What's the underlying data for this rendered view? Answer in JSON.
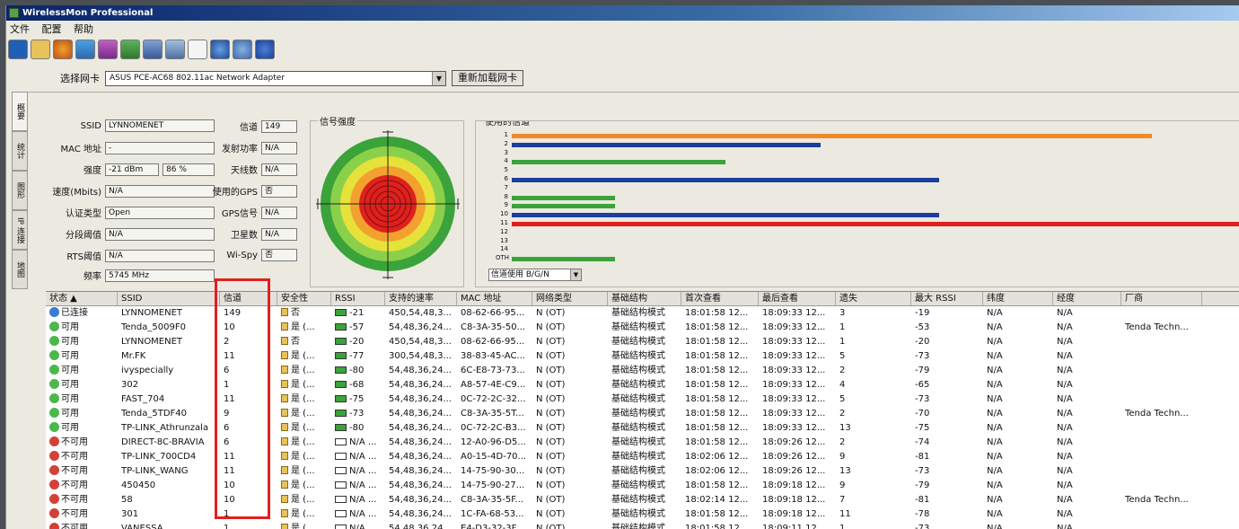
{
  "window": {
    "title": "WirelessMon Professional"
  },
  "menu": [
    "文件",
    "配置",
    "帮助"
  ],
  "toolbar": {
    "icons": [
      "save-icon",
      "open-icon",
      "refresh-icon",
      "scan-icon",
      "export-icon",
      "network-icon",
      "print-icon",
      "settings-icon",
      "doc-icon",
      "help-icon",
      "globe-icon",
      "info-icon"
    ]
  },
  "adapter": {
    "label": "选择网卡",
    "value": "ASUS PCE-AC68 802.11ac Network Adapter",
    "reload_label": "重新加载网卡"
  },
  "vtabs": [
    "概要",
    "统计",
    "图形",
    "IP 连接",
    "地图"
  ],
  "info": {
    "ssid_label": "SSID",
    "ssid": "LYNNOMENET",
    "mac_label": "MAC 地址",
    "mac": "-",
    "strength_label": "强度",
    "strength_dbm": "-21 dBm",
    "strength_pct": "86 %",
    "rate_label": "速度(Mbits)",
    "rate": "N/A",
    "auth_label": "认证类型",
    "auth": "Open",
    "frag_label": "分段阈值",
    "frag": "N/A",
    "rts_label": "RTS阈值",
    "rts": "N/A",
    "freq_label": "频率",
    "freq": "5745 MHz",
    "channel_label": "信道",
    "channel": "149",
    "txpower_label": "发射功率",
    "txpower": "N/A",
    "antenna_label": "天线数",
    "antenna": "N/A",
    "gps_label": "使用的GPS",
    "gps": "否",
    "gpssig_label": "GPS信号",
    "gpssig": "N/A",
    "sat_label": "卫星数",
    "sat": "N/A",
    "wispy_label": "Wi-Spy",
    "wispy": "否"
  },
  "signal": {
    "title": "信号强度"
  },
  "channels": {
    "title": "使用的信道",
    "labels": [
      "1",
      "2",
      "3",
      "4",
      "5",
      "6",
      "7",
      "8",
      "9",
      "10",
      "11",
      "12",
      "13",
      "14",
      "OTH"
    ],
    "bars": [
      {
        "ch": 1,
        "value": 0.87,
        "color": "#f0892a"
      },
      {
        "ch": 2,
        "value": 0.42,
        "color": "#1c3f9c"
      },
      {
        "ch": 4,
        "value": 0.29,
        "color": "#3aa33a"
      },
      {
        "ch": 6,
        "value": 0.58,
        "color": "#1c3f9c"
      },
      {
        "ch": 8,
        "value": 0.14,
        "color": "#3aa33a"
      },
      {
        "ch": 9,
        "value": 0.14,
        "color": "#3aa33a"
      },
      {
        "ch": 10,
        "value": 0.58,
        "color": "#1c3f9c"
      },
      {
        "ch": 11,
        "value": 1.0,
        "color": "#e0201d"
      },
      {
        "ch": 15,
        "value": 0.14,
        "color": "#3aa33a"
      }
    ],
    "band_select": "信道使用 B/G/N"
  },
  "table": {
    "headers": [
      "状态 ▲",
      "SSID",
      "信道",
      "安全性",
      "RSSI",
      "支持的速率",
      "MAC 地址",
      "网络类型",
      "基础结构",
      "首次查看",
      "最后查看",
      "遗失",
      "最大 RSSI",
      "纬度",
      "经度",
      "厂商"
    ],
    "rows": [
      {
        "status": "已连接",
        "dot": "#3a7bd5",
        "ssid": "LYNNOMENET",
        "channel": "149",
        "sec": "否",
        "rssi": "-21",
        "rates": "450,54,48,3...",
        "mac": "08-62-66-95...",
        "nettype": "N (OT)",
        "infra": "基础结构模式",
        "first": "18:01:58 12...",
        "last": "18:09:33 12...",
        "lost": "3",
        "maxrssi": "-19",
        "lat": "N/A",
        "lon": "N/A",
        "vendor": ""
      },
      {
        "status": "可用",
        "dot": "#4cb84c",
        "ssid": "Tenda_5009F0",
        "channel": "10",
        "sec": "是 (...",
        "rssi": "-57",
        "rates": "54,48,36,24...",
        "mac": "C8-3A-35-50...",
        "nettype": "N (OT)",
        "infra": "基础结构模式",
        "first": "18:01:58 12...",
        "last": "18:09:33 12...",
        "lost": "1",
        "maxrssi": "-53",
        "lat": "N/A",
        "lon": "N/A",
        "vendor": "Tenda Techn..."
      },
      {
        "status": "可用",
        "dot": "#4cb84c",
        "ssid": "LYNNOMENET",
        "channel": "2",
        "sec": "否",
        "rssi": "-20",
        "rates": "450,54,48,3...",
        "mac": "08-62-66-95...",
        "nettype": "N (OT)",
        "infra": "基础结构模式",
        "first": "18:01:58 12...",
        "last": "18:09:33 12...",
        "lost": "1",
        "maxrssi": "-20",
        "lat": "N/A",
        "lon": "N/A",
        "vendor": ""
      },
      {
        "status": "可用",
        "dot": "#4cb84c",
        "ssid": "Mr.FK",
        "channel": "11",
        "sec": "是 (...",
        "rssi": "-77",
        "rates": "300,54,48,3...",
        "mac": "38-83-45-AC...",
        "nettype": "N (OT)",
        "infra": "基础结构模式",
        "first": "18:01:58 12...",
        "last": "18:09:33 12...",
        "lost": "5",
        "maxrssi": "-73",
        "lat": "N/A",
        "lon": "N/A",
        "vendor": ""
      },
      {
        "status": "可用",
        "dot": "#4cb84c",
        "ssid": "ivyspecially",
        "channel": "6",
        "sec": "是 (...",
        "rssi": "-80",
        "rates": "54,48,36,24...",
        "mac": "6C-E8-73-73...",
        "nettype": "N (OT)",
        "infra": "基础结构模式",
        "first": "18:01:58 12...",
        "last": "18:09:33 12...",
        "lost": "2",
        "maxrssi": "-79",
        "lat": "N/A",
        "lon": "N/A",
        "vendor": ""
      },
      {
        "status": "可用",
        "dot": "#4cb84c",
        "ssid": "302",
        "channel": "1",
        "sec": "是 (...",
        "rssi": "-68",
        "rates": "54,48,36,24...",
        "mac": "A8-57-4E-C9...",
        "nettype": "N (OT)",
        "infra": "基础结构模式",
        "first": "18:01:58 12...",
        "last": "18:09:33 12...",
        "lost": "4",
        "maxrssi": "-65",
        "lat": "N/A",
        "lon": "N/A",
        "vendor": ""
      },
      {
        "status": "可用",
        "dot": "#4cb84c",
        "ssid": "FAST_704",
        "channel": "11",
        "sec": "是 (...",
        "rssi": "-75",
        "rates": "54,48,36,24...",
        "mac": "0C-72-2C-32...",
        "nettype": "N (OT)",
        "infra": "基础结构模式",
        "first": "18:01:58 12...",
        "last": "18:09:33 12...",
        "lost": "5",
        "maxrssi": "-73",
        "lat": "N/A",
        "lon": "N/A",
        "vendor": ""
      },
      {
        "status": "可用",
        "dot": "#4cb84c",
        "ssid": "Tenda_5TDF40",
        "channel": "9",
        "sec": "是 (...",
        "rssi": "-73",
        "rates": "54,48,36,24...",
        "mac": "C8-3A-35-5T...",
        "nettype": "N (OT)",
        "infra": "基础结构模式",
        "first": "18:01:58 12...",
        "last": "18:09:33 12...",
        "lost": "2",
        "maxrssi": "-70",
        "lat": "N/A",
        "lon": "N/A",
        "vendor": "Tenda Techn..."
      },
      {
        "status": "可用",
        "dot": "#4cb84c",
        "ssid": "TP-LINK_Athrunzala",
        "channel": "6",
        "sec": "是 (...",
        "rssi": "-80",
        "rates": "54,48,36,24...",
        "mac": "0C-72-2C-B3...",
        "nettype": "N (OT)",
        "infra": "基础结构模式",
        "first": "18:01:58 12...",
        "last": "18:09:33 12...",
        "lost": "13",
        "maxrssi": "-75",
        "lat": "N/A",
        "lon": "N/A",
        "vendor": ""
      },
      {
        "status": "不可用",
        "dot": "#d2403a",
        "ssid": "DIRECT-8C-BRAVIA",
        "channel": "6",
        "sec": "是 (...",
        "rssi": "N/A ...",
        "rates": "54,48,36,24...",
        "mac": "12-A0-96-D5...",
        "nettype": "N (OT)",
        "infra": "基础结构模式",
        "first": "18:01:58 12...",
        "last": "18:09:26 12...",
        "lost": "2",
        "maxrssi": "-74",
        "lat": "N/A",
        "lon": "N/A",
        "vendor": ""
      },
      {
        "status": "不可用",
        "dot": "#d2403a",
        "ssid": "TP-LINK_700CD4",
        "channel": "11",
        "sec": "是 (...",
        "rssi": "N/A ...",
        "rates": "54,48,36,24...",
        "mac": "A0-15-4D-70...",
        "nettype": "N (OT)",
        "infra": "基础结构模式",
        "first": "18:02:06 12...",
        "last": "18:09:26 12...",
        "lost": "9",
        "maxrssi": "-81",
        "lat": "N/A",
        "lon": "N/A",
        "vendor": ""
      },
      {
        "status": "不可用",
        "dot": "#d2403a",
        "ssid": "TP-LINK_WANG",
        "channel": "11",
        "sec": "是 (...",
        "rssi": "N/A ...",
        "rates": "54,48,36,24...",
        "mac": "14-75-90-30...",
        "nettype": "N (OT)",
        "infra": "基础结构模式",
        "first": "18:02:06 12...",
        "last": "18:09:26 12...",
        "lost": "13",
        "maxrssi": "-73",
        "lat": "N/A",
        "lon": "N/A",
        "vendor": ""
      },
      {
        "status": "不可用",
        "dot": "#d2403a",
        "ssid": "450450",
        "channel": "10",
        "sec": "是 (...",
        "rssi": "N/A ...",
        "rates": "54,48,36,24...",
        "mac": "14-75-90-27...",
        "nettype": "N (OT)",
        "infra": "基础结构模式",
        "first": "18:01:58 12...",
        "last": "18:09:18 12...",
        "lost": "9",
        "maxrssi": "-79",
        "lat": "N/A",
        "lon": "N/A",
        "vendor": ""
      },
      {
        "status": "不可用",
        "dot": "#d2403a",
        "ssid": "58",
        "channel": "10",
        "sec": "是 (...",
        "rssi": "N/A ...",
        "rates": "54,48,36,24...",
        "mac": "C8-3A-35-5F...",
        "nettype": "N (OT)",
        "infra": "基础结构模式",
        "first": "18:02:14 12...",
        "last": "18:09:18 12...",
        "lost": "7",
        "maxrssi": "-81",
        "lat": "N/A",
        "lon": "N/A",
        "vendor": "Tenda Techn..."
      },
      {
        "status": "不可用",
        "dot": "#d2403a",
        "ssid": "301",
        "channel": "1",
        "sec": "是 (...",
        "rssi": "N/A ...",
        "rates": "54,48,36,24...",
        "mac": "1C-FA-68-53...",
        "nettype": "N (OT)",
        "infra": "基础结构模式",
        "first": "18:01:58 12...",
        "last": "18:09:18 12...",
        "lost": "11",
        "maxrssi": "-78",
        "lat": "N/A",
        "lon": "N/A",
        "vendor": ""
      },
      {
        "status": "不可用",
        "dot": "#d2403a",
        "ssid": "VANESSA",
        "channel": "1",
        "sec": "是 (...",
        "rssi": "N/A ...",
        "rates": "54,48,36,24...",
        "mac": "E4-D3-32-3F...",
        "nettype": "N (OT)",
        "infra": "基础结构模式",
        "first": "18:01:58 12...",
        "last": "18:09:11 12...",
        "lost": "1",
        "maxrssi": "-73",
        "lat": "N/A",
        "lon": "N/A",
        "vendor": ""
      }
    ]
  }
}
